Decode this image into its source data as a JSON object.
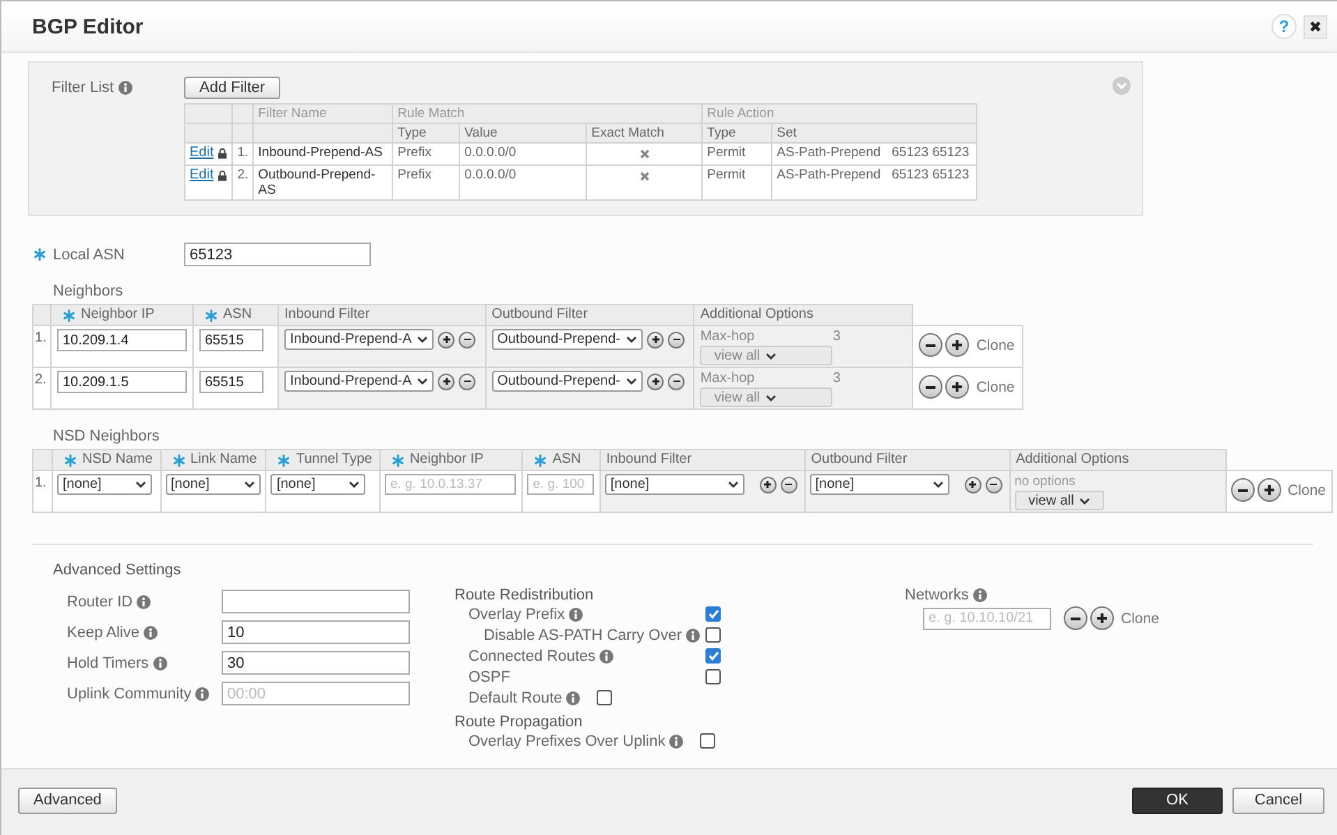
{
  "window": {
    "title": "BGP Editor",
    "help_button": "?",
    "close_button": "✖"
  },
  "filter_list": {
    "label": "Filter List",
    "info": true,
    "add_button": "Add Filter",
    "group_headers": [
      "Filter Name",
      "Rule Match",
      "Rule Action"
    ],
    "columns": [
      "Type",
      "Value",
      "Exact Match",
      "Type",
      "Set"
    ],
    "rows": [
      {
        "edit": "Edit",
        "locked": true,
        "index": "1.",
        "name": "Inbound-Prepend-AS",
        "match_type": "Prefix",
        "value": "0.0.0.0/0",
        "exact_match": false,
        "action_type": "Permit",
        "set_action": "AS-Path-Prepend",
        "set_value": "65123 65123"
      },
      {
        "edit": "Edit",
        "locked": true,
        "index": "2.",
        "name": "Outbound-Prepend-AS",
        "match_type": "Prefix",
        "value": "0.0.0.0/0",
        "exact_match": false,
        "action_type": "Permit",
        "set_action": "AS-Path-Prepend",
        "set_value": "65123 65123"
      }
    ]
  },
  "local_asn": {
    "label": "Local ASN",
    "required": true,
    "value": "65123"
  },
  "neighbors": {
    "title": "Neighbors",
    "columns": [
      {
        "label": "Neighbor IP",
        "required": true
      },
      {
        "label": "ASN",
        "required": true
      },
      {
        "label": "Inbound Filter",
        "required": false
      },
      {
        "label": "Outbound Filter",
        "required": false
      },
      {
        "label": "Additional Options",
        "required": false
      }
    ],
    "rows": [
      {
        "index": "1.",
        "neighbor_ip": {
          "value": "10.209.1.4"
        },
        "asn": {
          "value": "65515"
        },
        "inbound_filter": "Inbound-Prepend-A",
        "outbound_filter": "Outbound-Prepend-",
        "option_name": "Max-hop",
        "option_value": "3",
        "view_all": "view all",
        "clone": "Clone"
      },
      {
        "index": "2.",
        "neighbor_ip": {
          "value": "10.209.1.5"
        },
        "asn": {
          "value": "65515"
        },
        "inbound_filter": "Inbound-Prepend-A",
        "outbound_filter": "Outbound-Prepend-",
        "option_name": "Max-hop",
        "option_value": "3",
        "view_all": "view all",
        "clone": "Clone"
      }
    ]
  },
  "nsd_neighbors": {
    "title": "NSD Neighbors",
    "columns": [
      {
        "label": "NSD Name",
        "required": true
      },
      {
        "label": "Link Name",
        "required": true
      },
      {
        "label": "Tunnel Type",
        "required": true
      },
      {
        "label": "Neighbor IP",
        "required": true
      },
      {
        "label": "ASN",
        "required": true
      },
      {
        "label": "Inbound Filter",
        "required": false
      },
      {
        "label": "Outbound Filter",
        "required": false
      },
      {
        "label": "Additional Options",
        "required": false
      }
    ],
    "rows": [
      {
        "index": "1.",
        "nsd_name": "[none]",
        "link_name": "[none]",
        "tunnel_type": "[none]",
        "neighbor_ip": {
          "placeholder": "e. g. 10.0.13.37"
        },
        "asn": {
          "placeholder": "e. g. 100"
        },
        "inbound_filter": "[none]",
        "outbound_filter": "[none]",
        "options": "no options",
        "view_all": "view all",
        "clone": "Clone"
      }
    ]
  },
  "advanced_settings": {
    "title": "Advanced Settings",
    "fields": [
      {
        "label": "Router ID",
        "info": true
      },
      {
        "label": "Keep Alive",
        "info": true,
        "value": "10"
      },
      {
        "label": "Hold Timers",
        "info": true,
        "value": "30"
      },
      {
        "label": "Uplink Community",
        "info": true,
        "placeholder": "00:00"
      }
    ]
  },
  "route_redistribution": {
    "title": "Route Redistribution",
    "items": [
      {
        "label": "Overlay Prefix",
        "info": true,
        "checked": true,
        "kind": "column",
        "children": [
          {
            "label": "Disable AS-PATH Carry Over",
            "info": true,
            "checked": false,
            "kind": "column"
          }
        ]
      },
      {
        "label": "Connected Routes",
        "info": true,
        "checked": true,
        "kind": "column"
      },
      {
        "label": "OSPF",
        "info": false,
        "checked": false,
        "kind": "column"
      },
      {
        "label": "Default Route",
        "info": true,
        "checked": false,
        "kind": "inline"
      }
    ]
  },
  "route_propagation": {
    "title": "Route Propagation",
    "items": [
      {
        "label": "Overlay Prefixes Over Uplink",
        "info": true,
        "checked": false,
        "kind": "inline"
      }
    ]
  },
  "networks": {
    "label": "Networks",
    "info": true,
    "placeholder": "e. g. 10.10.10/21",
    "clone": "Clone"
  },
  "footer": {
    "advanced_button": "Advanced",
    "ok_button": "OK",
    "cancel_button": "Cancel"
  }
}
